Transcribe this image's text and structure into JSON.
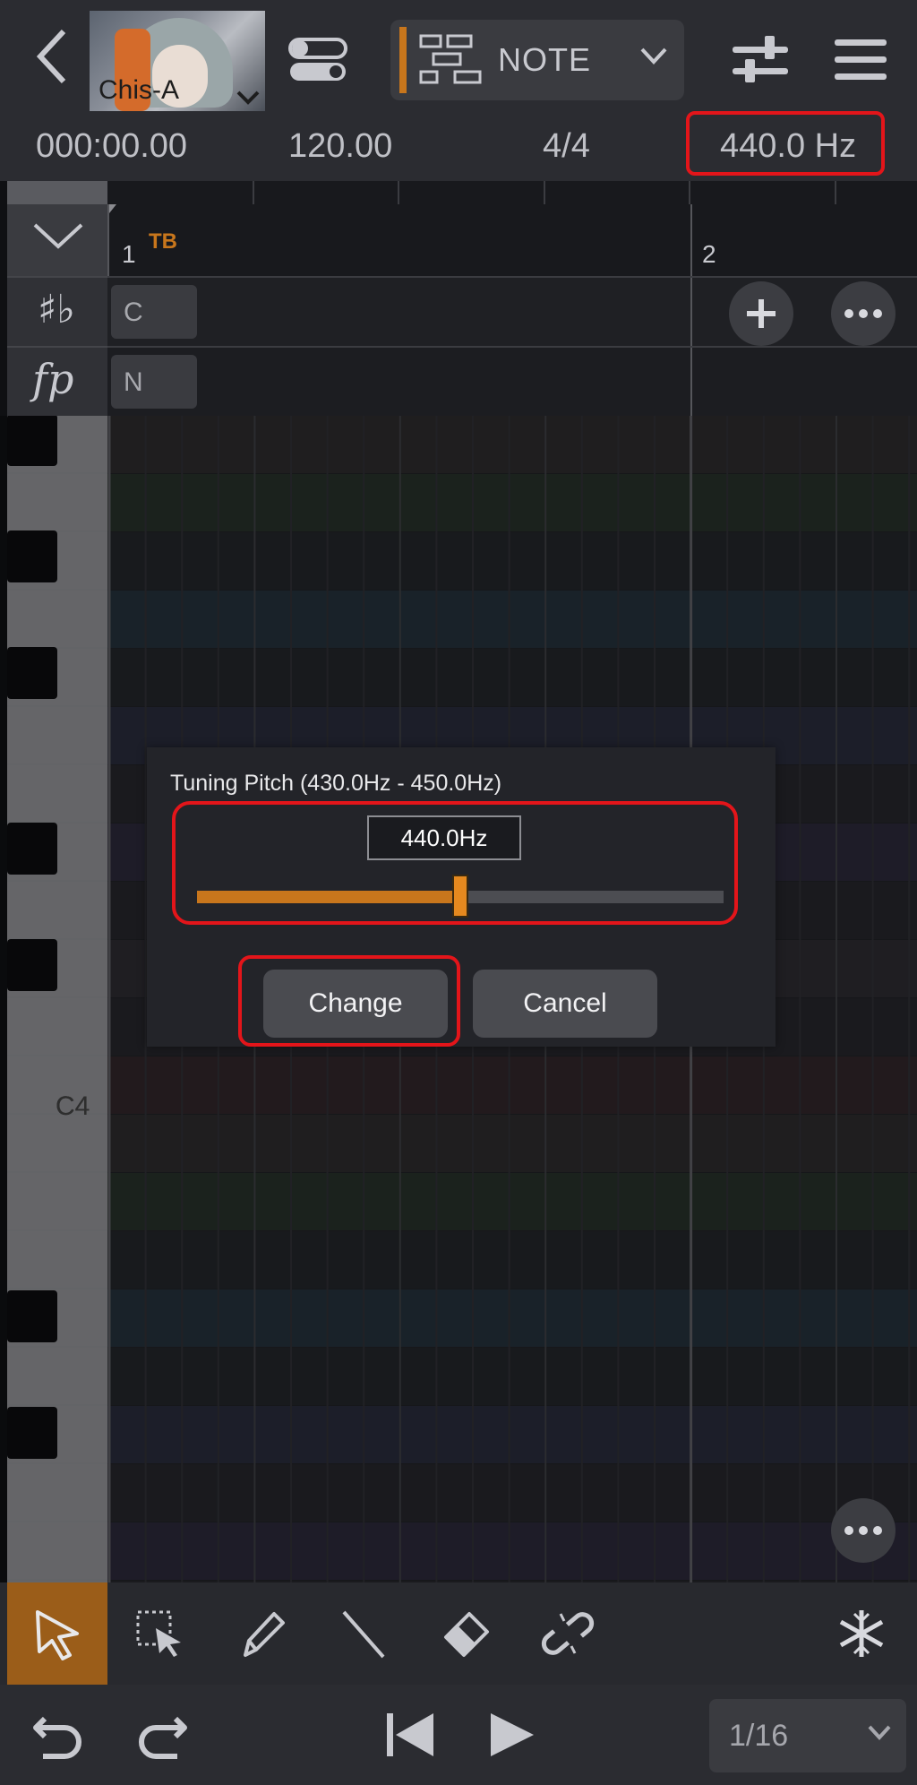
{
  "header": {
    "track_name": "Chis-A",
    "mode_label": "NOTE"
  },
  "status": {
    "time": "000:00.00",
    "tempo": "120.00",
    "meter": "4/4",
    "tuning": "440.0 Hz"
  },
  "timeline": {
    "measure1": "1",
    "measure1_tag": "TB",
    "measure2": "2"
  },
  "tracks": {
    "key_chip": "C",
    "dynamics_chip": "N"
  },
  "piano": {
    "c4_label": "C4"
  },
  "dialog": {
    "title": "Tuning Pitch (430.0Hz - 450.0Hz)",
    "value": "440.0Hz",
    "slider_level": 0.5,
    "change_label": "Change",
    "cancel_label": "Cancel"
  },
  "transport": {
    "quantize": "1/16"
  },
  "colors": {
    "accent": "#c8761c",
    "highlight": "#e3151a"
  }
}
